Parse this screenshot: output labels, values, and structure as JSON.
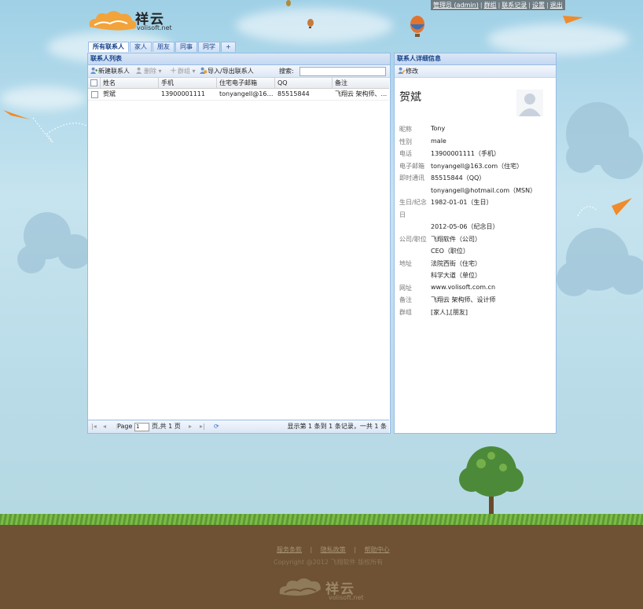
{
  "top_links": [
    "管理员 (admin)",
    "群组",
    "联系记录",
    "设置",
    "退出"
  ],
  "logo": {
    "text": "祥云",
    "sub": "volisoft.net"
  },
  "tabs": [
    "所有联系人",
    "家人",
    "朋友",
    "同事",
    "同学",
    "+"
  ],
  "list_panel": {
    "title": "联系人列表",
    "toolbar": {
      "new": "新建联系人",
      "delete": "删除",
      "group": "群组",
      "import_export": "导入/导出联系人",
      "search_label": "搜索:",
      "search_value": ""
    },
    "columns": [
      "姓名",
      "手机",
      "住宅电子邮箱",
      "QQ",
      "备注"
    ],
    "rows": [
      {
        "name": "贺斌",
        "mobile": "13900001111",
        "email": "tonyangell@163.c...",
        "qq": "85515844",
        "note": "飞翔云 架构师、..."
      }
    ],
    "pager": {
      "page_label": "Page",
      "page_value": "1",
      "of_pages": "页,共 1 页",
      "summary": "显示第 1 条到 1 条记录，一共 1 条"
    }
  },
  "detail_panel": {
    "title": "联系人详细信息",
    "edit": "修改",
    "name": "贺斌",
    "fields": [
      {
        "label": "昵称",
        "value": "Tony"
      },
      {
        "label": "性别",
        "value": "male"
      },
      {
        "label": "电话",
        "value": "13900001111（手机）"
      },
      {
        "label": "电子邮箱",
        "value": "tonyangell@163.com（住宅）"
      },
      {
        "label": "即时通讯",
        "value": "85515844（QQ）"
      },
      {
        "label": "",
        "value": "tonyangell@hotmail.com（MSN）"
      },
      {
        "label": "生日/纪念",
        "value": "1982-01-01（生日）"
      },
      {
        "label": "日",
        "value": ""
      },
      {
        "label": "",
        "value": "2012-05-06（纪念日）"
      },
      {
        "label": "公司/职位",
        "value": "飞翔软件（公司）"
      },
      {
        "label": "",
        "value": "CEO（职位）"
      },
      {
        "label": "地址",
        "value": "法院西街（住宅）"
      },
      {
        "label": "",
        "value": "科学大道（单位）"
      },
      {
        "label": "网址",
        "value": "www.volisoft.com.cn"
      },
      {
        "label": "备注",
        "value": "飞翔云 架构师、设计师"
      },
      {
        "label": "群组",
        "value": "[家人],[朋友]"
      }
    ]
  },
  "footer": {
    "links": [
      "服务条款",
      "隐私政策",
      "帮助中心"
    ],
    "copyright": "Copyright @2012 飞翔软件 版权所有",
    "logo_text": "祥云",
    "logo_sub": "volisoft.net"
  }
}
